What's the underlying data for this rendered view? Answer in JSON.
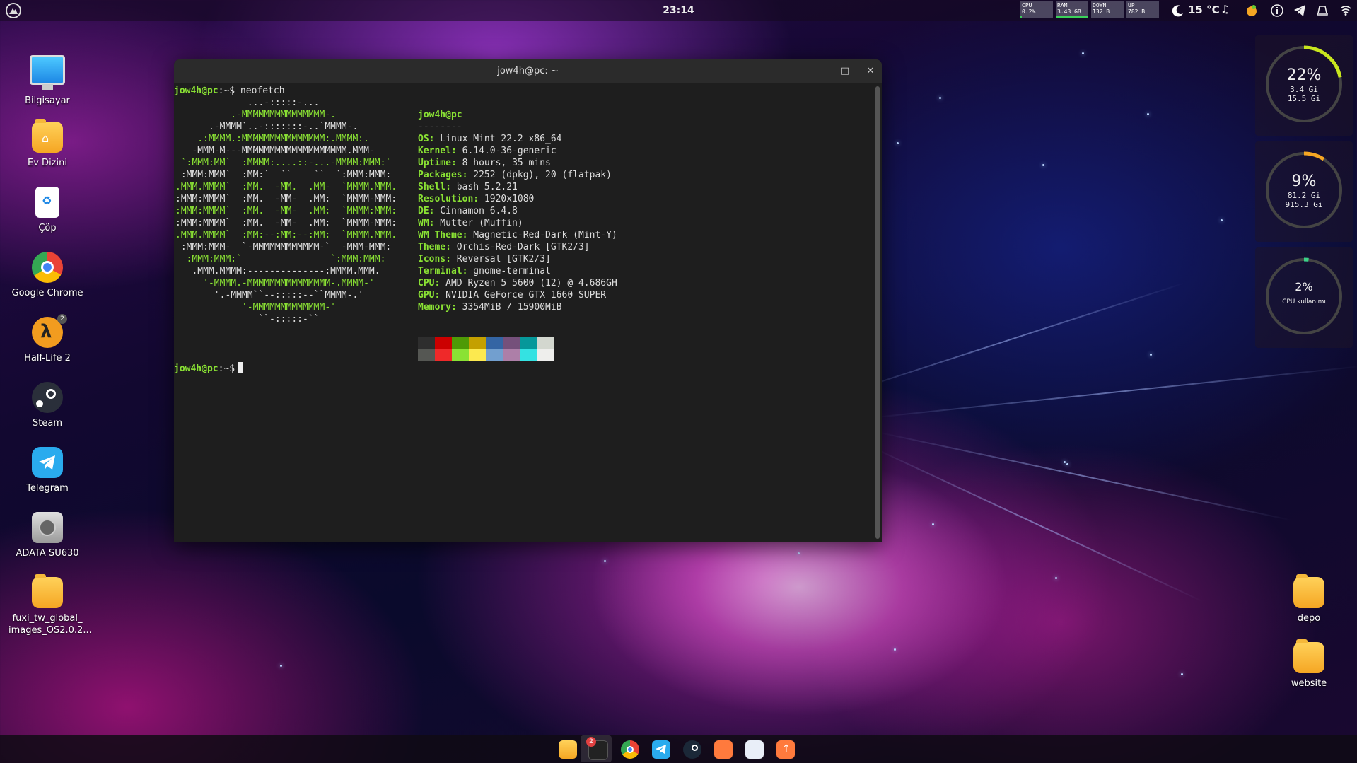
{
  "topbar": {
    "clock": "23:14",
    "sysmon": [
      {
        "label": "CPU",
        "value": "0.2%"
      },
      {
        "label": "RAM",
        "value": "3.43 GB"
      },
      {
        "label": "DOWN",
        "value": "132 B"
      },
      {
        "label": "UP",
        "value": "782 B"
      }
    ],
    "weather": "15 °C",
    "tray_icons": [
      "moon-icon",
      "music-icon",
      "fruit-icon",
      "info-icon",
      "telegram-icon",
      "notifications-icon",
      "wifi-icon"
    ]
  },
  "desktop": {
    "icons": [
      {
        "label": "Bilgisayar",
        "icon": "computer-icon"
      },
      {
        "label": "Ev Dizini",
        "icon": "home-folder-icon"
      },
      {
        "label": "Çöp",
        "icon": "trash-icon"
      },
      {
        "label": "Google Chrome",
        "icon": "chrome-icon"
      },
      {
        "label": "Half-Life 2",
        "icon": "half-life-icon",
        "badge": "2"
      },
      {
        "label": "Steam",
        "icon": "steam-icon"
      },
      {
        "label": "Telegram",
        "icon": "telegram-icon"
      },
      {
        "label": "ADATA SU630",
        "icon": "drive-icon"
      },
      {
        "label": "fuxi_tw_global_\nimages_OS2.0.2...",
        "icon": "folder-icon"
      }
    ],
    "right_icons": [
      {
        "label": "depo",
        "icon": "folder-icon"
      },
      {
        "label": "website",
        "icon": "folder-icon"
      }
    ]
  },
  "terminal": {
    "title": "jow4h@pc: ~",
    "prompt": "jow4h@pc",
    "prompt_suffix": ":~$",
    "command": " neofetch",
    "ascii": [
      "             ...-:::::-...",
      "          .-MMMMMMMMMMMMMMM-.",
      "      .-MMMM`..-:::::::-..`MMMM-.",
      "    .:MMMM.:MMMMMMMMMMMMMMM:.MMMM:.",
      "   -MMM-M---MMMMMMMMMMMMMMMMMMM.MMM-",
      " `:MMM:MM`  :MMMM:....::-...-MMMM:MMM:`",
      " :MMM:MMM`  :MM:`  ``    ``  `:MMM:MMM:",
      ".MMM.MMMM`  :MM.  -MM.  .MM-  `MMMM.MMM.",
      ":MMM:MMMM`  :MM.  -MM-  .MM:  `MMMM-MMM:",
      ":MMM:MMMM`  :MM.  -MM-  .MM:  `MMMM:MMM:",
      ":MMM:MMMM`  :MM.  -MM-  .MM:  `MMMM-MMM:",
      ".MMM.MMMM`  :MM:--:MM:--:MM:  `MMMM.MMM.",
      " :MMM:MMM-  `-MMMMMMMMMMMM-`  -MMM-MMM:",
      "  :MMM:MMM:`                `:MMM:MMM:",
      "   .MMM.MMMM:--------------:MMMM.MMM.",
      "     '-MMMM.-MMMMMMMMMMMMMMM-.MMMM-'",
      "       '.-MMMM``--:::::--``MMMM-.'",
      "            '-MMMMMMMMMMMMM-'",
      "               ``-:::::-``"
    ],
    "info_title": "jow4h@pc",
    "info_sep": "--------",
    "info": [
      {
        "k": "OS",
        "v": " Linux Mint 22.2 x86_64"
      },
      {
        "k": "Kernel",
        "v": " 6.14.0-36-generic"
      },
      {
        "k": "Uptime",
        "v": " 8 hours, 35 mins"
      },
      {
        "k": "Packages",
        "v": " 2252 (dpkg), 20 (flatpak)"
      },
      {
        "k": "Shell",
        "v": " bash 5.2.21"
      },
      {
        "k": "Resolution",
        "v": " 1920x1080"
      },
      {
        "k": "DE",
        "v": " Cinnamon 6.4.8"
      },
      {
        "k": "WM",
        "v": " Mutter (Muffin)"
      },
      {
        "k": "WM Theme",
        "v": " Magnetic-Red-Dark (Mint-Y)"
      },
      {
        "k": "Theme",
        "v": " Orchis-Red-Dark [GTK2/3]"
      },
      {
        "k": "Icons",
        "v": " Reversal [GTK2/3]"
      },
      {
        "k": "Terminal",
        "v": " gnome-terminal"
      },
      {
        "k": "CPU",
        "v": " AMD Ryzen 5 5600 (12) @ 4.686GH"
      },
      {
        "k": "GPU",
        "v": " NVIDIA GeForce GTX 1660 SUPER"
      },
      {
        "k": "Memory",
        "v": " 3354MiB / 15900MiB"
      }
    ],
    "palette_top": [
      "#2e2e2e",
      "#cc0000",
      "#4e9a06",
      "#c4a000",
      "#3465a4",
      "#75507b",
      "#06989a",
      "#d3d7cf"
    ],
    "palette_bottom": [
      "#555753",
      "#ef2929",
      "#8ae234",
      "#fce94f",
      "#729fcf",
      "#ad7fa8",
      "#34e2e2",
      "#eeeeec"
    ]
  },
  "widgets": [
    {
      "pct": "22%",
      "line1": "3.4 Gi",
      "line2": "15.5 Gi",
      "fraction": 0.22,
      "color": "#c8e61e"
    },
    {
      "pct": "9%",
      "line1": "81.2 Gi",
      "line2": "915.3 Gi",
      "fraction": 0.09,
      "color": "#f5a623"
    },
    {
      "pct": "2%",
      "line1": "CPU kullanımı",
      "line2": "",
      "fraction": 0.02,
      "color": "#3bd18a"
    }
  ],
  "dock": {
    "items": [
      "files-icon",
      "terminal-icon",
      "chrome-icon",
      "telegram-icon",
      "steam-icon",
      "shop-icon",
      "app-icon",
      "update-icon"
    ],
    "terminal_badge": "2"
  }
}
